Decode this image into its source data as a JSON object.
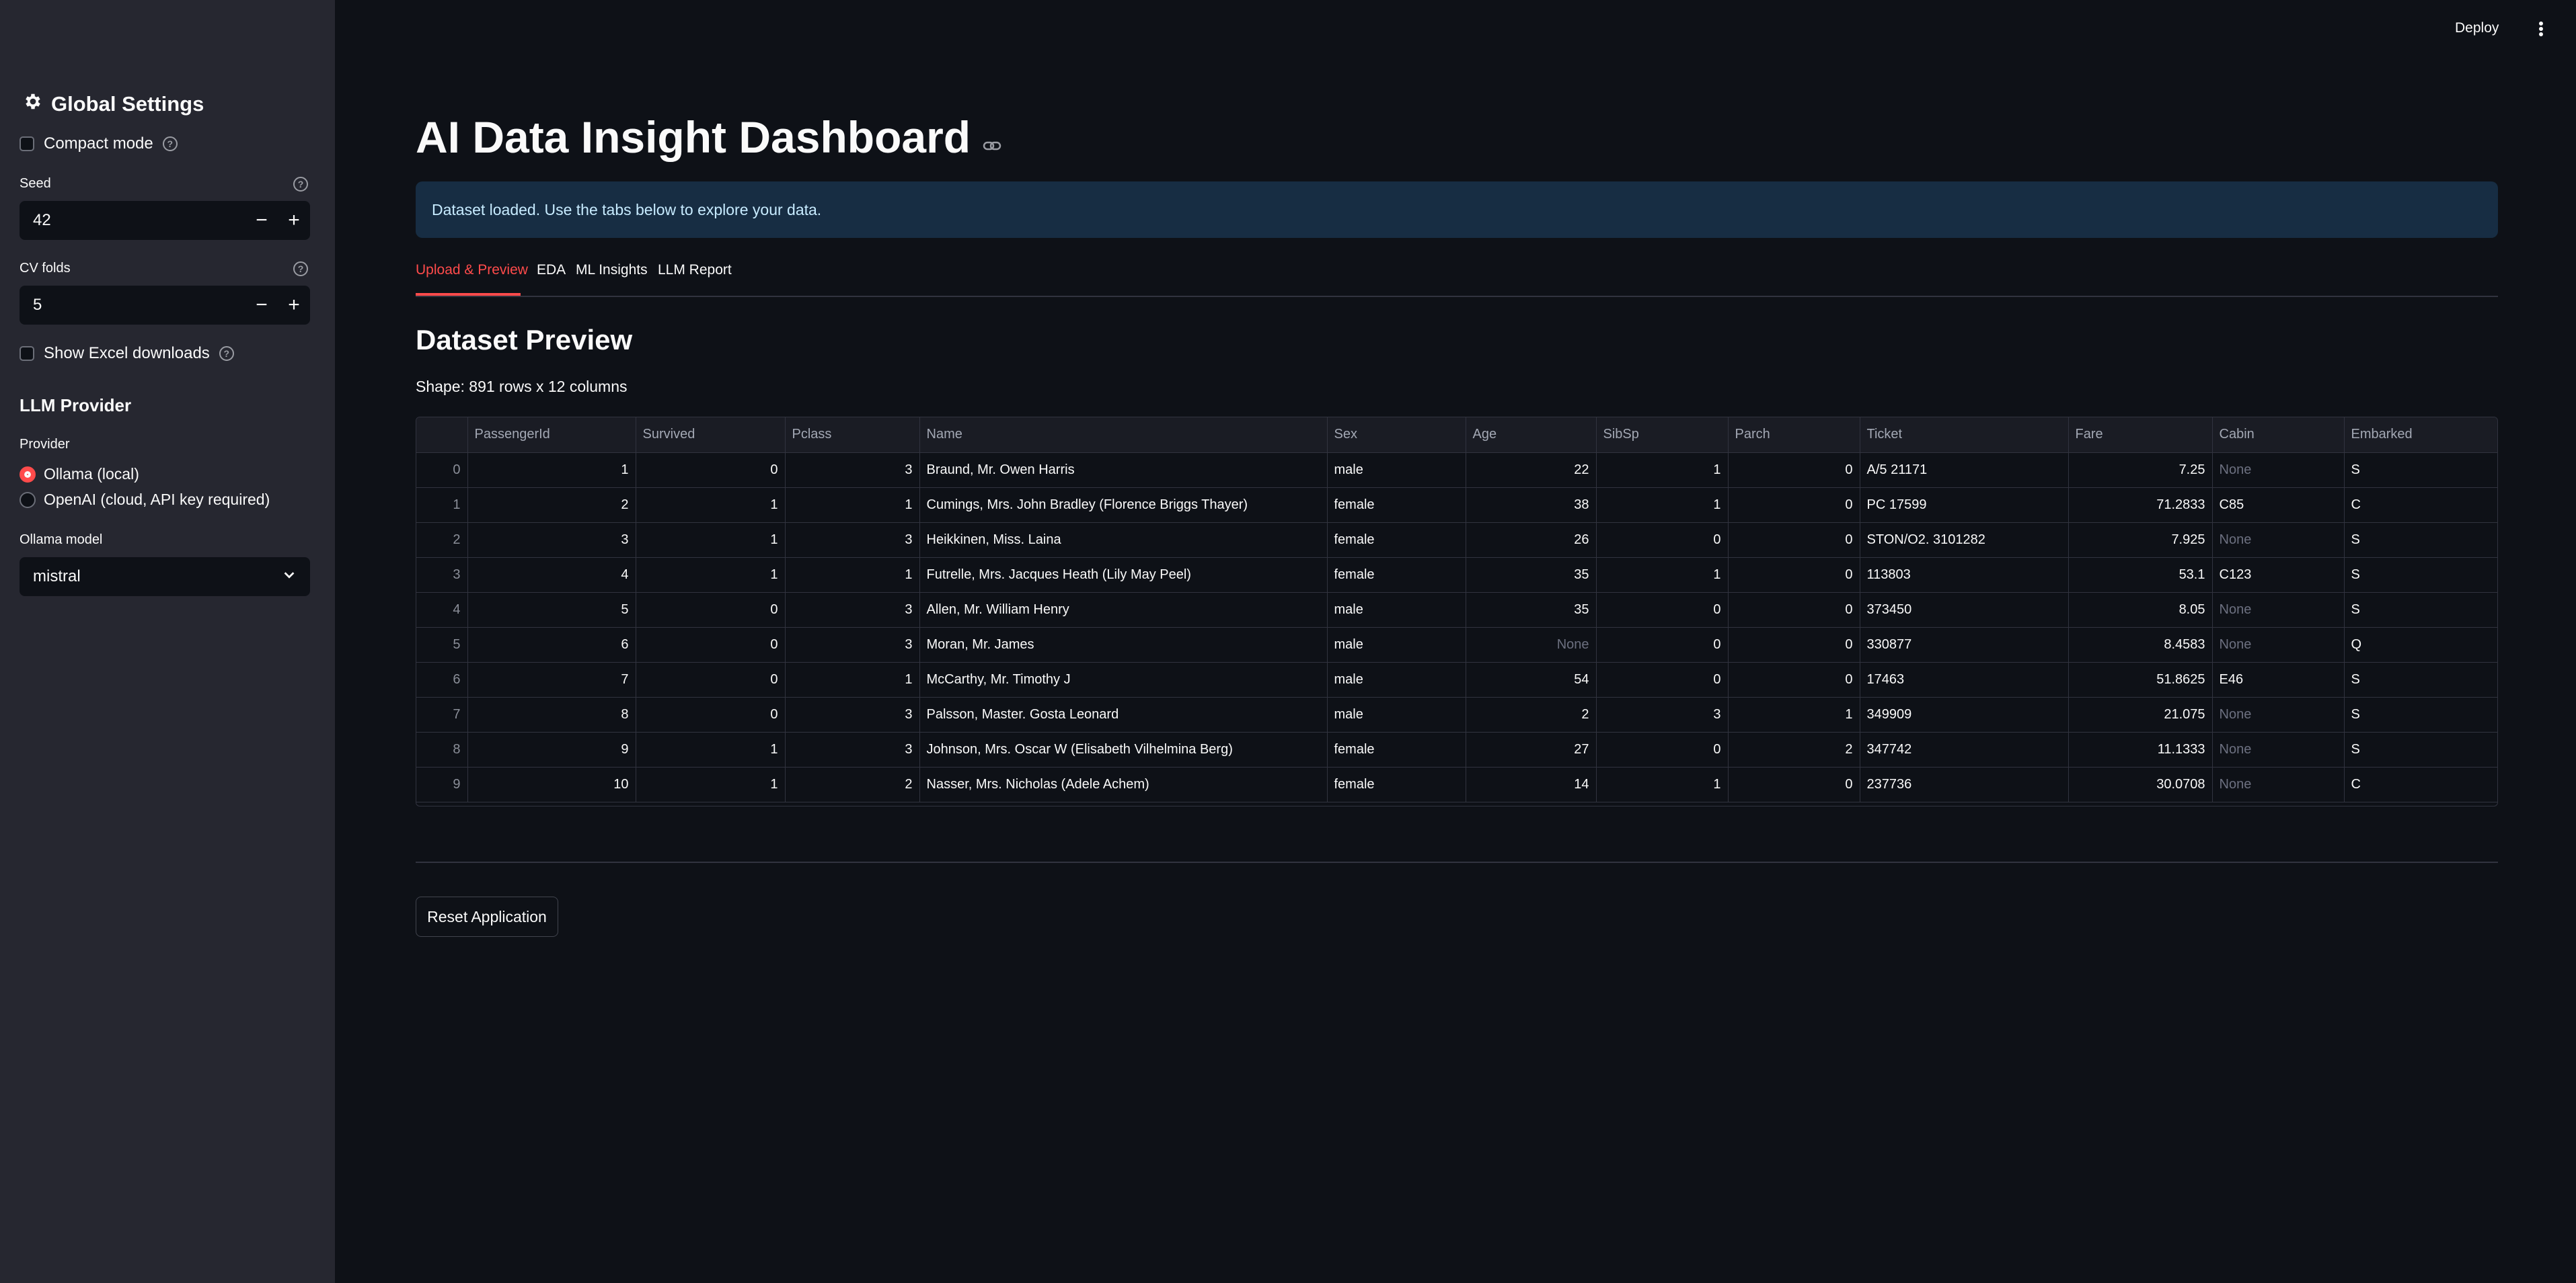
{
  "topbar": {
    "deploy_label": "Deploy",
    "menu_icon": "kebab-menu-icon"
  },
  "sidebar": {
    "title": "Global Settings",
    "title_icon": "gear-icon",
    "compact_mode_label": "Compact mode",
    "seed_label": "Seed",
    "seed_value": "42",
    "cv_folds_label": "CV folds",
    "cv_folds_value": "5",
    "show_excel_label": "Show Excel downloads",
    "llm_provider_heading": "LLM Provider",
    "provider_label": "Provider",
    "provider_options": [
      "Ollama (local)",
      "OpenAI (cloud, API key required)"
    ],
    "provider_selected": "Ollama (local)",
    "ollama_model_label": "Ollama model",
    "ollama_model_value": "mistral",
    "minus": "−",
    "plus": "+"
  },
  "main": {
    "title": "AI Data Insight Dashboard",
    "info_message": "Dataset loaded. Use the tabs below to explore your data.",
    "tabs": [
      "Upload & Preview",
      "EDA",
      "ML Insights",
      "LLM Report"
    ],
    "active_tab": "Upload & Preview",
    "section_title": "Dataset Preview",
    "shape_text": "Shape: 891 rows x 12 columns",
    "reset_label": "Reset Application"
  },
  "colors": {
    "accent": "#ff4b4b",
    "background": "#0e1117",
    "sidebar": "#262730",
    "info_bg": "#172d43"
  },
  "table": {
    "columns": [
      "",
      "PassengerId",
      "Survived",
      "Pclass",
      "Name",
      "Sex",
      "Age",
      "SibSp",
      "Parch",
      "Ticket",
      "Fare",
      "Cabin",
      "Embarked"
    ],
    "rows": [
      [
        "0",
        "1",
        "0",
        "3",
        "Braund, Mr. Owen Harris",
        "male",
        "22",
        "1",
        "0",
        "A/5 21171",
        "7.25",
        "None",
        "S"
      ],
      [
        "1",
        "2",
        "1",
        "1",
        "Cumings, Mrs. John Bradley (Florence Briggs Thayer)",
        "female",
        "38",
        "1",
        "0",
        "PC 17599",
        "71.2833",
        "C85",
        "C"
      ],
      [
        "2",
        "3",
        "1",
        "3",
        "Heikkinen, Miss. Laina",
        "female",
        "26",
        "0",
        "0",
        "STON/O2. 3101282",
        "7.925",
        "None",
        "S"
      ],
      [
        "3",
        "4",
        "1",
        "1",
        "Futrelle, Mrs. Jacques Heath (Lily May Peel)",
        "female",
        "35",
        "1",
        "0",
        "113803",
        "53.1",
        "C123",
        "S"
      ],
      [
        "4",
        "5",
        "0",
        "3",
        "Allen, Mr. William Henry",
        "male",
        "35",
        "0",
        "0",
        "373450",
        "8.05",
        "None",
        "S"
      ],
      [
        "5",
        "6",
        "0",
        "3",
        "Moran, Mr. James",
        "male",
        "None",
        "0",
        "0",
        "330877",
        "8.4583",
        "None",
        "Q"
      ],
      [
        "6",
        "7",
        "0",
        "1",
        "McCarthy, Mr. Timothy J",
        "male",
        "54",
        "0",
        "0",
        "17463",
        "51.8625",
        "E46",
        "S"
      ],
      [
        "7",
        "8",
        "0",
        "3",
        "Palsson, Master. Gosta Leonard",
        "male",
        "2",
        "3",
        "1",
        "349909",
        "21.075",
        "None",
        "S"
      ],
      [
        "8",
        "9",
        "1",
        "3",
        "Johnson, Mrs. Oscar W (Elisabeth Vilhelmina Berg)",
        "female",
        "27",
        "0",
        "2",
        "347742",
        "11.1333",
        "None",
        "S"
      ],
      [
        "9",
        "10",
        "1",
        "2",
        "Nasser, Mrs. Nicholas (Adele Achem)",
        "female",
        "14",
        "1",
        "0",
        "237736",
        "30.0708",
        "None",
        "C"
      ]
    ]
  }
}
